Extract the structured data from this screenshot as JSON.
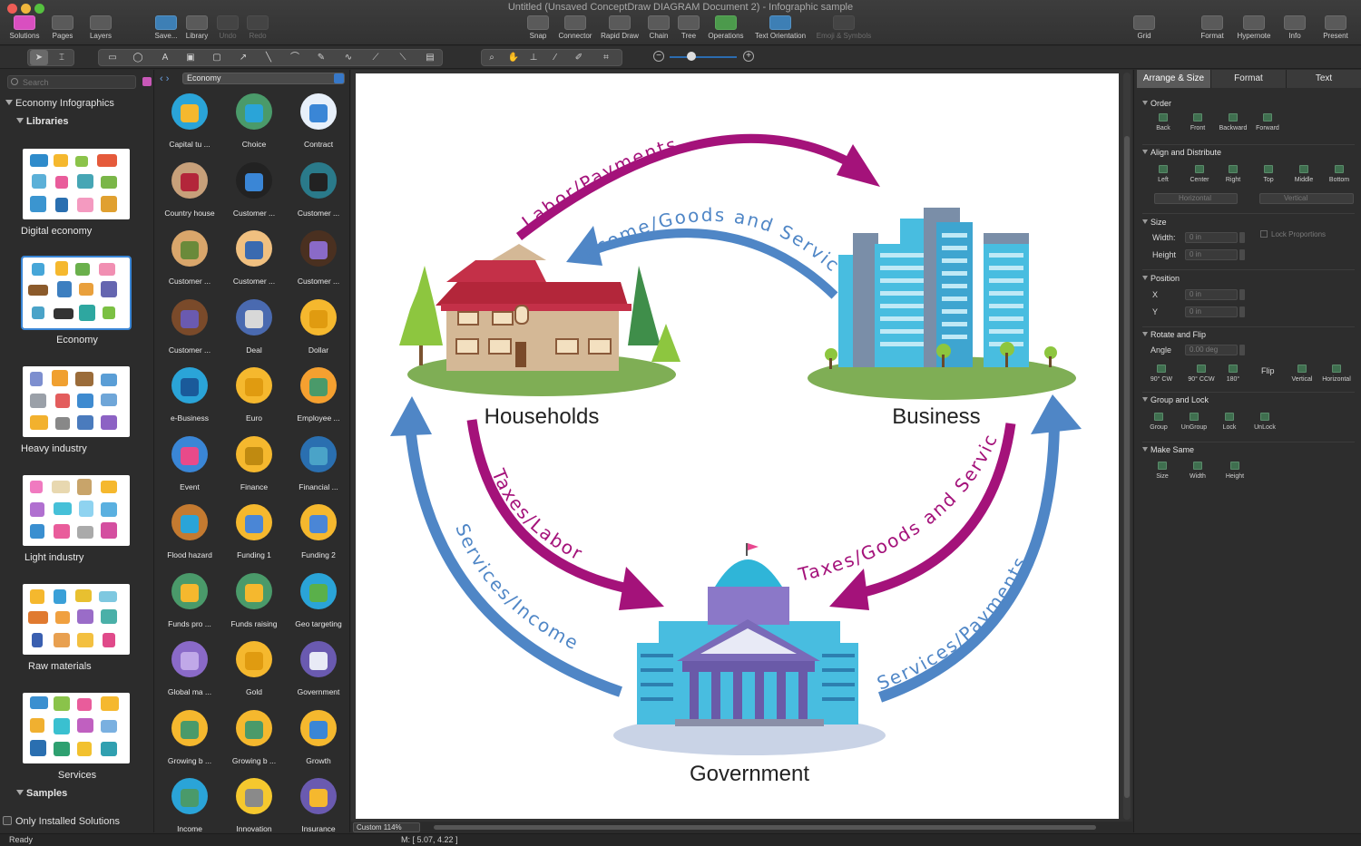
{
  "window": {
    "title": "Untitled (Unsaved ConceptDraw DIAGRAM Document 2) - Infographic sample"
  },
  "toolbar": {
    "left": [
      {
        "label": "Solutions",
        "icon": "solutions-icon"
      },
      {
        "label": "Pages",
        "icon": "pages-icon"
      },
      {
        "label": "Layers",
        "icon": "layers-icon"
      },
      {
        "label": "Save...",
        "icon": "save-icon"
      },
      {
        "label": "Library",
        "icon": "library-icon"
      },
      {
        "label": "Undo",
        "icon": "undo-icon"
      },
      {
        "label": "Redo",
        "icon": "redo-icon"
      }
    ],
    "center": [
      {
        "label": "Snap",
        "icon": "snap-icon"
      },
      {
        "label": "Connector",
        "icon": "connector-icon"
      },
      {
        "label": "Rapid Draw",
        "icon": "rapid-draw-icon"
      },
      {
        "label": "Chain",
        "icon": "chain-icon"
      },
      {
        "label": "Tree",
        "icon": "tree-icon"
      },
      {
        "label": "Operations",
        "icon": "operations-icon"
      },
      {
        "label": "Text Orientation",
        "icon": "text-orientation-icon"
      },
      {
        "label": "Emoji & Symbols",
        "icon": "emoji-icon"
      }
    ],
    "right": [
      {
        "label": "Grid",
        "icon": "grid-icon"
      },
      {
        "label": "Format",
        "icon": "format-icon"
      },
      {
        "label": "Hypernote",
        "icon": "hypernote-icon"
      },
      {
        "label": "Info",
        "icon": "info-icon"
      },
      {
        "label": "Present",
        "icon": "present-icon"
      }
    ]
  },
  "left_panel": {
    "search_placeholder": "Search",
    "solution": "Economy Infographics",
    "libraries_label": "Libraries",
    "libraries": [
      "Digital economy",
      "Economy",
      "Heavy industry",
      "Light industry",
      "Raw materials",
      "Services"
    ],
    "selected_library": "Economy",
    "samples_label": "Samples",
    "only_installed": "Only Installed Solutions"
  },
  "palette": {
    "selected": "Economy",
    "items": [
      "Capital tu ...",
      "Choice",
      "Contract",
      "Country house",
      "Customer ...",
      "Customer ...",
      "Customer ...",
      "Customer ...",
      "Customer ...",
      "Customer ...",
      "Deal",
      "Dollar",
      "e-Business",
      "Euro",
      "Employee ...",
      "Event",
      "Finance",
      "Financial ...",
      "Flood hazard",
      "Funding 1",
      "Funding 2",
      "Funds pro ...",
      "Funds raising",
      "Geo targeting",
      "Global ma ...",
      "Gold",
      "Government",
      "Growing b ...",
      "Growing b ...",
      "Growth",
      "Income",
      "Innovation",
      "Insurance"
    ]
  },
  "diagram": {
    "nodes": {
      "households": "Households",
      "business": "Business",
      "government": "Government"
    },
    "flows": {
      "labor_payments": "Labor/Payments",
      "income_goods_services": "Income/Goods and Services",
      "taxes_labor": "Taxes/Labor",
      "services_income": "Services/Income",
      "taxes_goods_services": "Taxes/Goods and Services",
      "services_payments": "Services/Payments"
    },
    "colors": {
      "magenta": "#a4127a",
      "blue": "#4f86c6"
    }
  },
  "canvas": {
    "zoom": "Custom 114%"
  },
  "status": {
    "text": "Ready",
    "mouse": "M: [ 5.07, 4.22 ]"
  },
  "right_panel": {
    "tabs": [
      "Arrange & Size",
      "Format",
      "Text"
    ],
    "active_tab": "Arrange & Size",
    "order": {
      "title": "Order",
      "buttons": [
        "Back",
        "Front",
        "Backward",
        "Forward"
      ]
    },
    "align": {
      "title": "Align and Distribute",
      "buttons": [
        "Left",
        "Center",
        "Right",
        "Top",
        "Middle",
        "Bottom"
      ],
      "horizontal": "Horizontal",
      "vertical": "Vertical"
    },
    "size": {
      "title": "Size",
      "width_label": "Width:",
      "height_label": "Height",
      "width": "0 in",
      "height": "0 in",
      "lock": "Lock Proportions"
    },
    "position": {
      "title": "Position",
      "x_label": "X",
      "y_label": "Y",
      "x": "0 in",
      "y": "0 in"
    },
    "rotate": {
      "title": "Rotate and Flip",
      "angle_label": "Angle",
      "angle": "0.00 deg",
      "buttons": [
        "90° CW",
        "90° CCW",
        "180°"
      ],
      "flip_label": "Flip",
      "flip_buttons": [
        "Vertical",
        "Horizontal"
      ]
    },
    "group": {
      "title": "Group and Lock",
      "buttons": [
        "Group",
        "UnGroup",
        "Lock",
        "UnLock"
      ]
    },
    "make_same": {
      "title": "Make Same",
      "buttons": [
        "Size",
        "Width",
        "Height"
      ]
    }
  }
}
